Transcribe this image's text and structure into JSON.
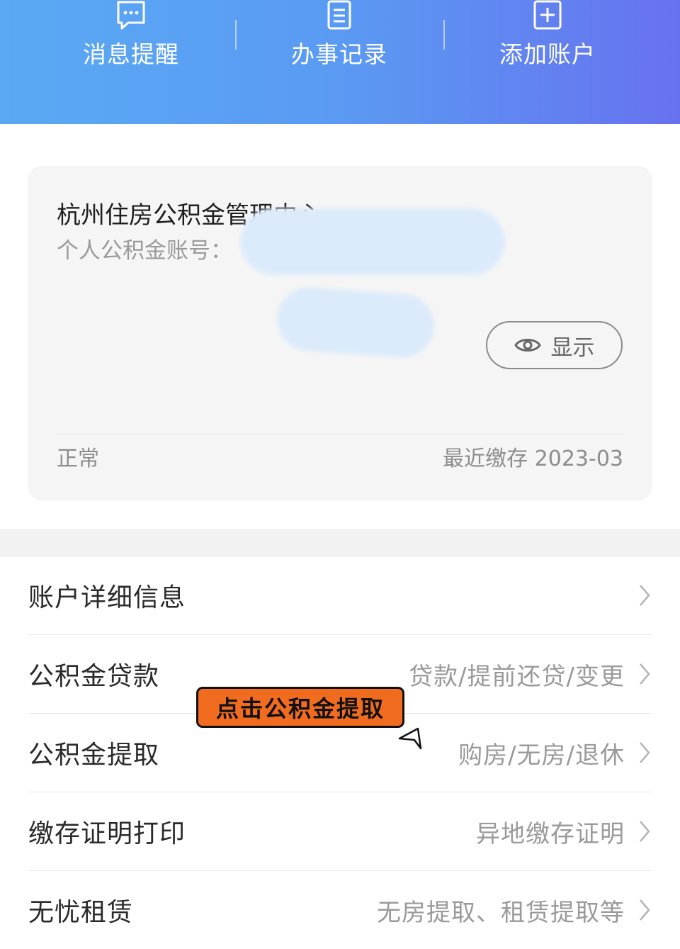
{
  "quick_actions": [
    {
      "label": "消息提醒",
      "icon": "message-icon"
    },
    {
      "label": "办事记录",
      "icon": "clipboard-icon"
    },
    {
      "label": "添加账户",
      "icon": "add-box-icon"
    }
  ],
  "card": {
    "title": "杭州住房公积金管理中心",
    "account_label": "个人公积金账号：",
    "show_label": "显示",
    "status": "正常",
    "recent_deposit": "最近缴存 2023-03"
  },
  "menu": [
    {
      "title": "账户详细信息",
      "subtitle": ""
    },
    {
      "title": "公积金贷款",
      "subtitle": "贷款/提前还贷/变更"
    },
    {
      "title": "公积金提取",
      "subtitle": "购房/无房/退休"
    },
    {
      "title": "缴存证明打印",
      "subtitle": "异地缴存证明"
    },
    {
      "title": "无忧租赁",
      "subtitle": "无房提取、租赁提取等"
    }
  ],
  "annotation": {
    "callout": "点击公积金提取"
  },
  "colors": {
    "banner_start": "#5aa9f4",
    "banner_end": "#6772ef",
    "callout": "#f26c1f"
  }
}
